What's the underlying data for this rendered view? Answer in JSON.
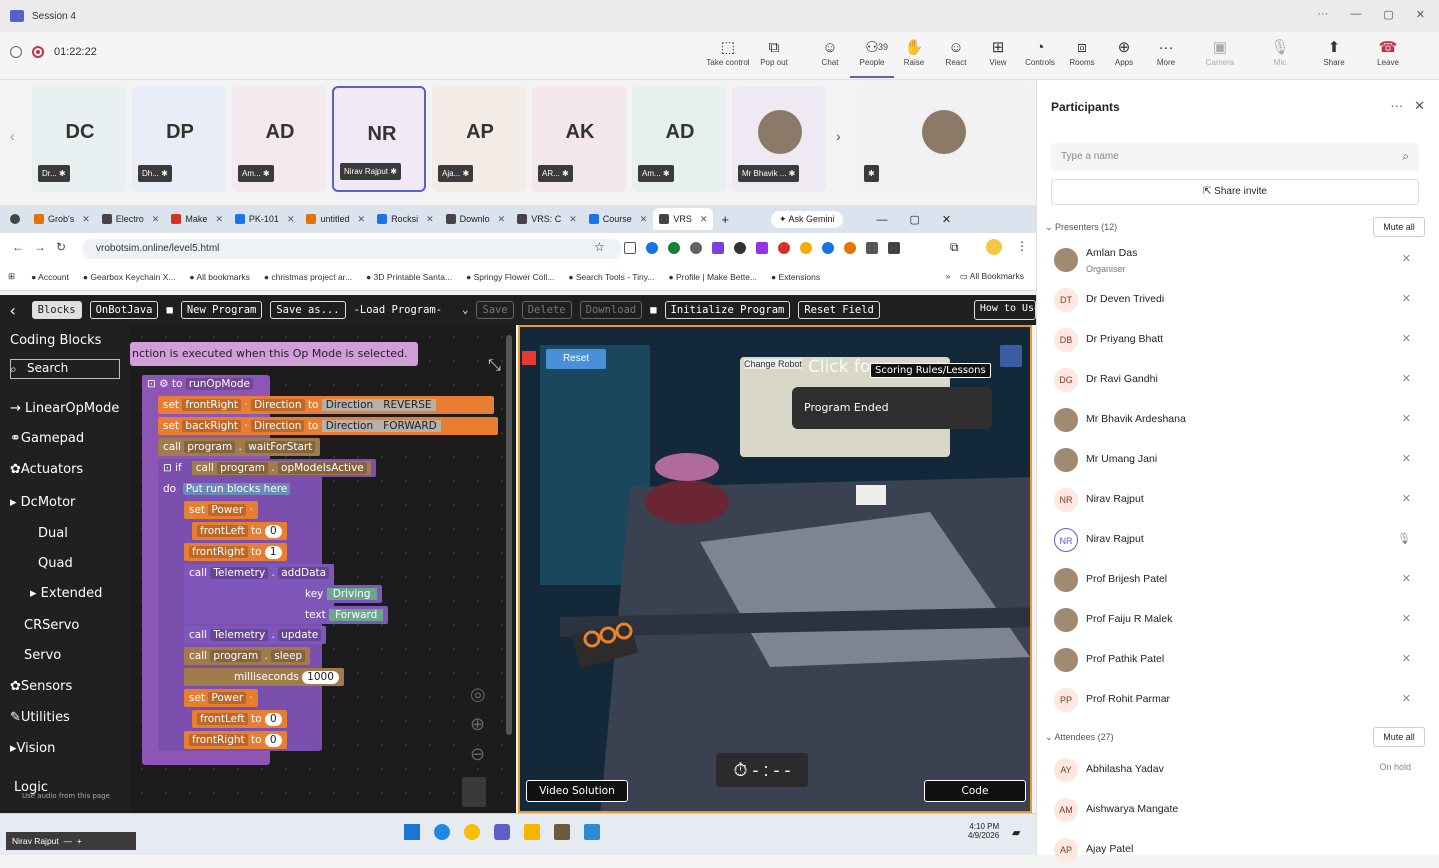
{
  "window": {
    "title": "Session 4",
    "controls": [
      "···",
      "—",
      "▢",
      "✕"
    ]
  },
  "meeting": {
    "timer": "01:22:22",
    "people_count": "39",
    "toolbar": [
      {
        "label": "Take control",
        "icon": "take-control-icon",
        "glyph": "⬚"
      },
      {
        "label": "Pop out",
        "icon": "pop-out-icon",
        "glyph": "⧉"
      },
      {
        "label": "Chat",
        "icon": "chat-icon",
        "glyph": "☺"
      },
      {
        "label": "People",
        "icon": "people-icon",
        "glyph": "⚇"
      },
      {
        "label": "Raise",
        "icon": "raise-hand-icon",
        "glyph": "✋"
      },
      {
        "label": "React",
        "icon": "react-icon",
        "glyph": "☺"
      },
      {
        "label": "View",
        "icon": "view-icon",
        "glyph": "⊞"
      },
      {
        "label": "Controls",
        "icon": "controls-icon",
        "glyph": "◔"
      },
      {
        "label": "Rooms",
        "icon": "rooms-icon",
        "glyph": "⧈"
      },
      {
        "label": "Apps",
        "icon": "apps-icon",
        "glyph": "⊕"
      },
      {
        "label": "More",
        "icon": "more-icon",
        "glyph": "···"
      },
      {
        "label": "Camera",
        "icon": "camera-off-icon",
        "glyph": "▣"
      },
      {
        "label": "Mic",
        "icon": "mic-off-icon",
        "glyph": "🎙"
      },
      {
        "label": "Share",
        "icon": "share-icon",
        "glyph": "⬆"
      },
      {
        "label": "Leave",
        "icon": "leave-icon",
        "glyph": "☎"
      }
    ]
  },
  "tiles": [
    {
      "initials": "DC",
      "label": "Dr... ",
      "bg": "#e9f0f2"
    },
    {
      "initials": "DP",
      "label": "Dh... ",
      "bg": "#e8edf7"
    },
    {
      "initials": "AD",
      "label": "Am... ",
      "bg": "#f3e9ef"
    },
    {
      "initials": "NR",
      "label": "Nirav Rajput",
      "bg": "#f1eaf6"
    },
    {
      "initials": "AP",
      "label": "Aja... ",
      "bg": "#f3ece6"
    },
    {
      "initials": "AK",
      "label": "AR... ",
      "bg": "#f4e7ec"
    },
    {
      "initials": "AD",
      "label": "Am... ",
      "bg": "#e6f1ef"
    },
    {
      "initials": "",
      "label": "Mr Bhavik ...",
      "bg": "#efe9f3"
    },
    {
      "initials": "",
      "label": "",
      "bg": "#f1f1f1"
    }
  ],
  "participants": {
    "title": "Participants",
    "search_placeholder": "Type a name",
    "share_invite": "Share invite",
    "presenters_label": "Presenters (12)",
    "attendees_label": "Attendees (27)",
    "mute_all": "Mute all",
    "presenters": [
      {
        "initials": "",
        "name": "Amlan Das",
        "sub": "Organiser",
        "photo": true
      },
      {
        "initials": "DT",
        "name": "Dr Deven Trivedi"
      },
      {
        "initials": "DB",
        "name": "Dr Priyang Bhatt"
      },
      {
        "initials": "DG",
        "name": "Dr Ravi Gandhi"
      },
      {
        "initials": "",
        "name": "Mr Bhavik Ardeshana",
        "photo": true
      },
      {
        "initials": "",
        "name": "Mr Umang Jani",
        "photo": true
      },
      {
        "initials": "NR",
        "name": "Nirav Rajput"
      },
      {
        "initials": "NR",
        "name": "Nirav Rajput",
        "ring": true
      },
      {
        "initials": "",
        "name": "Prof Brijesh Patel",
        "photo": true
      },
      {
        "initials": "",
        "name": "Prof Faiju R Malek",
        "photo": true
      },
      {
        "initials": "",
        "name": "Prof Pathik Patel",
        "photo": true
      },
      {
        "initials": "PP",
        "name": "Prof Rohit Parmar"
      }
    ],
    "attendees": [
      {
        "initials": "AY",
        "name": "Abhilasha Yadav",
        "status": "On hold"
      },
      {
        "initials": "AM",
        "name": "Aishwarya Mangate",
        "status": ""
      },
      {
        "initials": "AP",
        "name": "Ajay Patel",
        "status": ""
      }
    ]
  },
  "browser": {
    "tabs": [
      "Grob's",
      "Electro",
      "Make",
      "PK-101",
      "untitled",
      "Rocksi",
      "Downlo",
      "VRS: C",
      "Course",
      "VRS"
    ],
    "ask_gemini": "Ask Gemini",
    "url": "vrobotsim.online/level5.html",
    "bookmarks": [
      "Account",
      "Gearbox Keychain X...",
      "All bookmarks",
      "christmas project ar...",
      "3D Printable Santa...",
      "Springy Flower Coll...",
      "Search Tools - Tiny...",
      "Profile | Make Bette...",
      "Extensions"
    ],
    "all_bookmarks": "All Bookmarks"
  },
  "app": {
    "toolbar": [
      "Blocks",
      "OnBotJava",
      "New Program",
      "Save as..."
    ],
    "load_program": "-Load Program-",
    "dim_buttons": [
      "Save",
      "Delete",
      "Download"
    ],
    "init": "Initialize Program",
    "reset_field": "Reset Field",
    "how_to": "How to Use",
    "sidebar_title": "Coding Blocks",
    "search": "Search",
    "categories": [
      "LinearOpMode",
      "Gamepad",
      "Actuators",
      "DcMotor",
      "Dual",
      "Quad",
      "Extended",
      "CRServo",
      "Servo",
      "Sensors",
      "Utilities",
      "Vision",
      "Logic"
    ],
    "tooltip": "nction is executed when this Op Mode is selected.",
    "audio_hint": "Use audio from this page",
    "blocks": {
      "to": "to",
      "run_op_mode": "runOpMode",
      "set": "set",
      "front_right": "frontRight",
      "back_right": "backRight",
      "direction": "Direction",
      "reverse": "REVERSE",
      "forward": "FORWARD",
      "call": "call",
      "program": "program",
      "wait_for_start": "waitForStart",
      "if": "if",
      "do": "do",
      "op_mode_is_active": "opModeIsActive",
      "put_run": "Put run blocks here",
      "power": "Power",
      "front_left": "frontLeft",
      "zero": "0",
      "one": "1",
      "telemetry": "Telemetry",
      "add_data": "addData",
      "key": "key",
      "text": "text",
      "driving": "Driving",
      "forward_text": "Forward",
      "update": "update",
      "sleep": "sleep",
      "milliseconds": "milliseconds",
      "ms_value": "1000"
    },
    "sim": {
      "reset": "Reset",
      "change_robot": "Change Robot",
      "click_for": "Click for",
      "scoring": "Scoring Rules/Lessons",
      "program_ended": "Program Ended",
      "timer": "- : - -",
      "video_solution": "Video Solution",
      "code": "Code"
    }
  },
  "taskbar": {
    "user": "Nirav Rajput",
    "time": "4:10 PM",
    "date": "4/9/2026"
  }
}
